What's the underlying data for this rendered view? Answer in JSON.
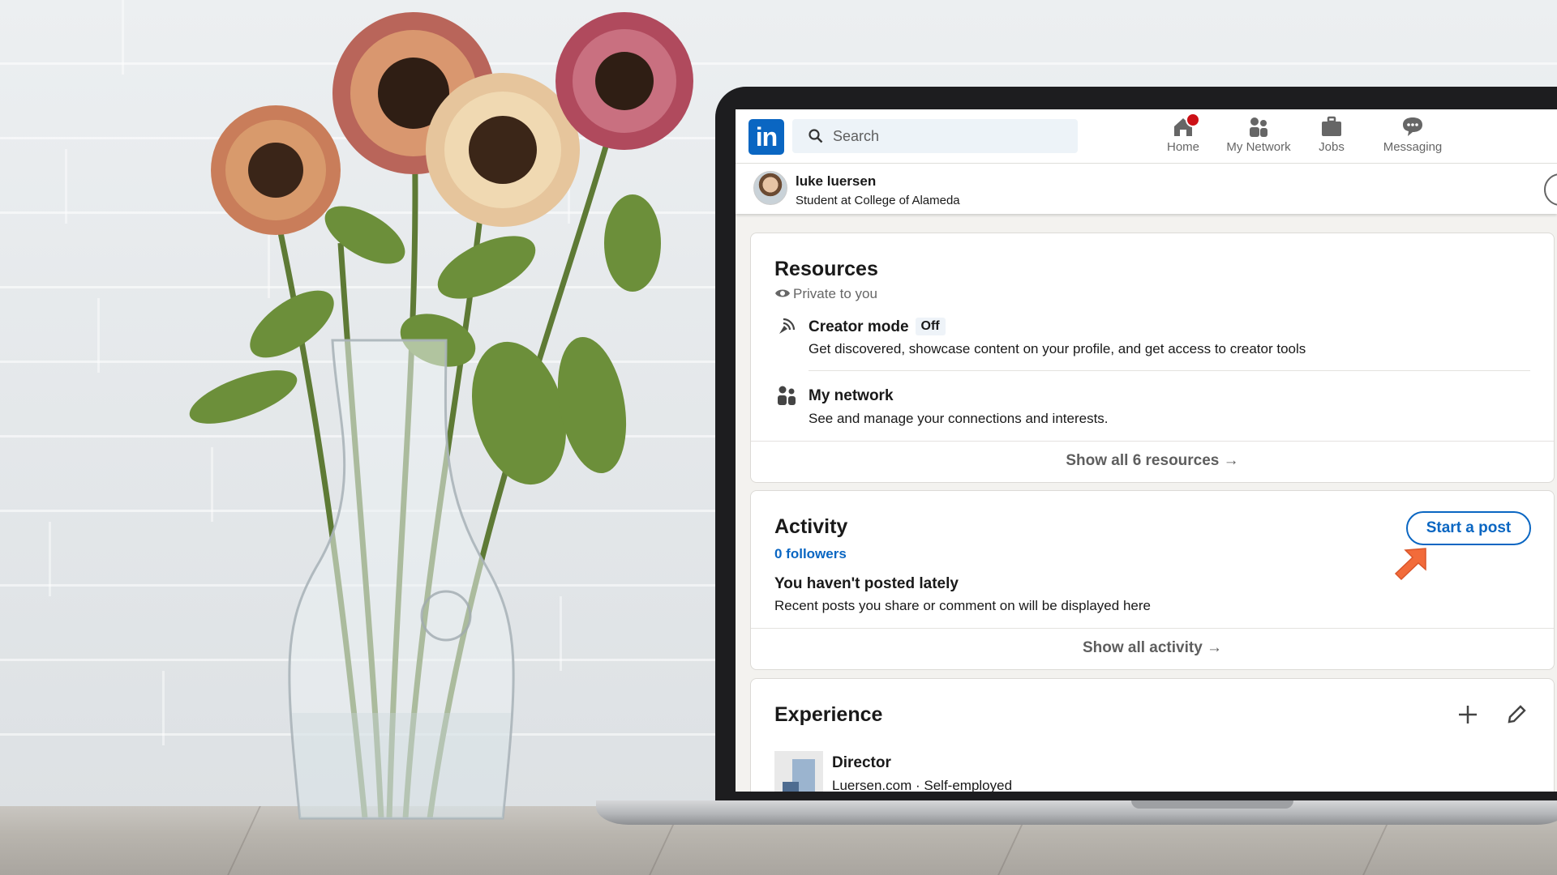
{
  "nav": {
    "search_placeholder": "Search",
    "items": [
      {
        "label": "Home",
        "icon": "home-icon"
      },
      {
        "label": "My Network",
        "icon": "network-icon"
      },
      {
        "label": "Jobs",
        "icon": "briefcase-icon"
      },
      {
        "label": "Messaging",
        "icon": "messaging-icon"
      }
    ]
  },
  "profile": {
    "name": "luke luersen",
    "headline": "Student at College of Alameda"
  },
  "resources": {
    "title": "Resources",
    "privacy": "Private to you",
    "items": [
      {
        "title": "Creator mode",
        "badge": "Off",
        "description": "Get discovered, showcase content on your profile, and get access to creator tools"
      },
      {
        "title": "My network",
        "description": "See and manage your connections and interests."
      }
    ],
    "show_all": "Show all 6 resources →"
  },
  "activity": {
    "title": "Activity",
    "followers": "0 followers",
    "start_post": "Start a post",
    "empty_title": "You haven't posted lately",
    "empty_desc": "Recent posts you share or comment on will be displayed here",
    "show_all": "Show all activity →"
  },
  "experience": {
    "title": "Experience",
    "items": [
      {
        "role": "Director",
        "company": "Luersen.com · Self-employed"
      }
    ]
  },
  "colors": {
    "brand": "#0a66c2",
    "annotation_arrow": "#f26b3a"
  }
}
